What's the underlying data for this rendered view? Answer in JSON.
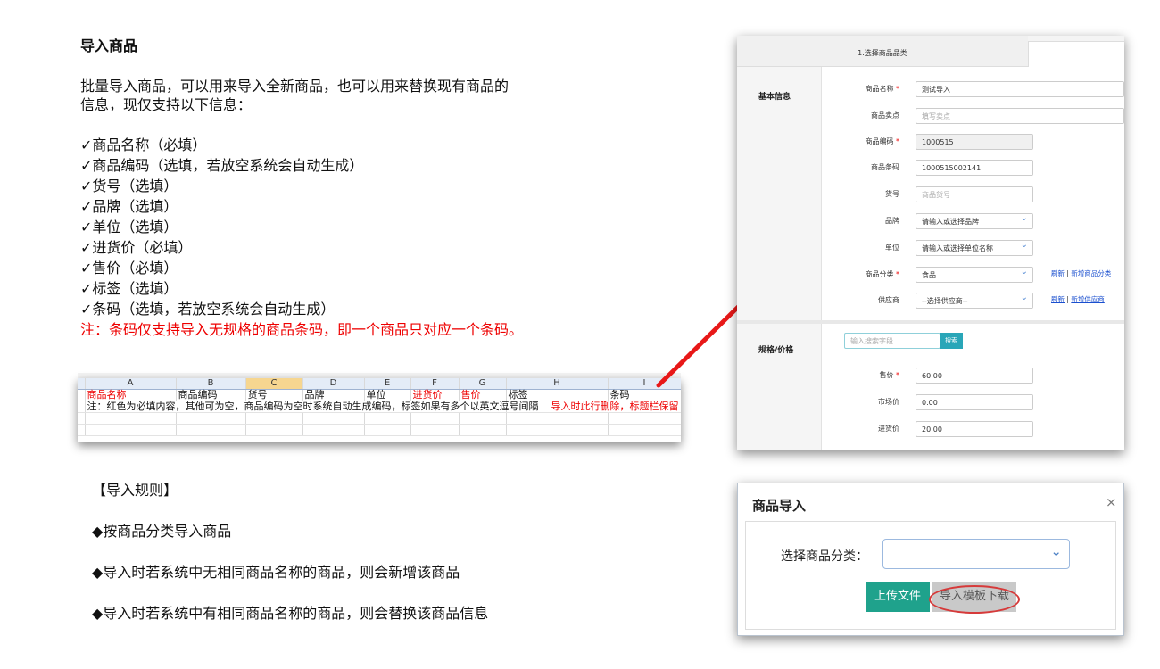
{
  "doc": {
    "title": "导入商品",
    "intro_lines": [
      "批量导入商品，可以用来导入全新商品，也可以用来替换现有商品的",
      "信息，现仅支持以下信息："
    ],
    "requirements": [
      "✓商品名称（必填）",
      "✓商品编码（选填，若放空系统会自动生成）",
      "✓货号（选填）",
      "✓品牌（选填）",
      "✓单位（选填）",
      "✓进货价（必填）",
      "✓售价（必填）",
      "✓标签（选填）",
      "✓条码（选填，若放空系统会自动生成）"
    ],
    "note": "注：条码仅支持导入无规格的商品条码，即一个商品只对应一个条码。",
    "rules_title": "【导入规则】",
    "rules": [
      "◆按商品分类导入商品",
      "◆导入时若系统中无相同商品名称的商品，则会新增该商品",
      "◆导入时若系统中有相同商品名称的商品，则会替换该商品信息"
    ]
  },
  "spreadsheet": {
    "columns": [
      "A",
      "B",
      "C",
      "D",
      "E",
      "F",
      "G",
      "H",
      "I"
    ],
    "selected_column": "C",
    "header_row": [
      "商品名称",
      "商品编码",
      "货号",
      "品牌",
      "单位",
      "进货价",
      "售价",
      "标签",
      "条码"
    ],
    "red_headers": [
      "商品名称",
      "进货价",
      "售价"
    ],
    "note_row_text": "注：红色为必填内容，其他可为空，商品编码为空时系统自动生成编码，标签如果有多个以英文逗号间隔",
    "note_row_red": "导入时此行删除，标题栏保留"
  },
  "product_form": {
    "tabs": [
      "1.选择商品品类"
    ],
    "basic_section": "基本信息",
    "fields": [
      {
        "label": "商品名称",
        "required": true,
        "value": "测试导入",
        "placeholder": ""
      },
      {
        "label": "商品卖点",
        "required": false,
        "value": "",
        "placeholder": "填写卖点"
      },
      {
        "label": "商品编码",
        "required": true,
        "value": "1000515",
        "placeholder": ""
      },
      {
        "label": "商品条码",
        "required": false,
        "value": "1000515002141",
        "placeholder": ""
      },
      {
        "label": "货号",
        "required": false,
        "value": "",
        "placeholder": "商品货号"
      },
      {
        "label": "品牌",
        "required": false,
        "value": "请输入或选择品牌",
        "placeholder": ""
      },
      {
        "label": "单位",
        "required": false,
        "value": "请输入或选择单位名称",
        "placeholder": ""
      },
      {
        "label": "商品分类",
        "required": true,
        "value": "食品",
        "placeholder": ""
      },
      {
        "label": "供应商",
        "required": false,
        "value": "--选择供应商--",
        "placeholder": ""
      }
    ],
    "category_links": [
      "刷新",
      "新增商品分类"
    ],
    "supplier_links": [
      "刷新",
      "新增供应商"
    ],
    "link_sep": "|",
    "spec_section": "规格/价格",
    "search_placeholder": "输入搜索字段",
    "search_button": "搜索",
    "price_fields": [
      {
        "label": "售价",
        "required": true,
        "value": "60.00"
      },
      {
        "label": "市场价",
        "required": false,
        "value": "0.00"
      },
      {
        "label": "进货价",
        "required": false,
        "value": "20.00"
      }
    ],
    "required_mark": "*"
  },
  "import_dialog": {
    "title": "商品导入",
    "close": "×",
    "category_label": "选择商品分类：",
    "category_value": "",
    "upload_button": "上传文件",
    "template_button": "导入模板下载"
  },
  "accent_colors": {
    "arrow": "#e81818",
    "note": "#e00000",
    "upload": "#1fa28c",
    "search": "#29a6b8"
  }
}
